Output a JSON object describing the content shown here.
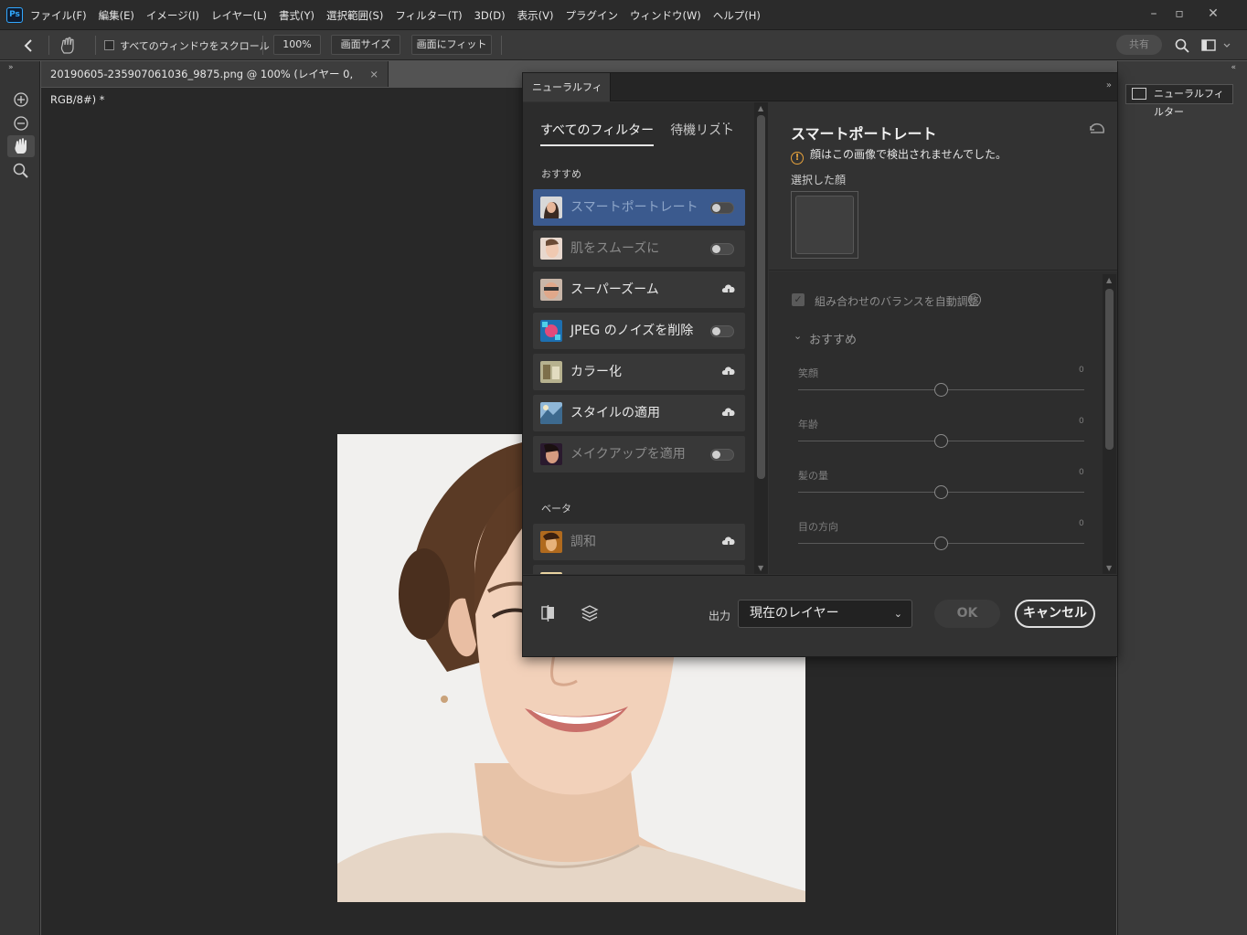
{
  "app": {
    "logo": "Ps",
    "menu": [
      "ファイル(F)",
      "編集(E)",
      "イメージ(I)",
      "レイヤー(L)",
      "書式(Y)",
      "選択範囲(S)",
      "フィルター(T)",
      "3D(D)",
      "表示(V)",
      "プラグイン",
      "ウィンドウ(W)",
      "ヘルプ(H)"
    ]
  },
  "options_bar": {
    "scroll_all_label": "すべてのウィンドウをスクロール",
    "zoom": "100%",
    "screen_size": "画面サイズ",
    "fit_screen": "画面にフィット",
    "share": "共有"
  },
  "document": {
    "tab_title": "20190605-235907061036_9875.png @ 100% (レイヤー 0, RGB/8#) *",
    "close": "×"
  },
  "right_dock": {
    "neural_filters_button": "ニューラルフィルター"
  },
  "neural_filters": {
    "panel_tab": "ニューラルフィルター",
    "tabs": {
      "all": "すべてのフィルター",
      "waitlist": "待機リスト",
      "more": "···"
    },
    "featured_label": "おすすめ",
    "beta_label": "ベータ",
    "filters": [
      {
        "name": "スマートポートレート",
        "state": "toggle-off",
        "selected": true,
        "dim": true
      },
      {
        "name": "肌をスムーズに",
        "state": "toggle-off",
        "selected": false,
        "dim": true
      },
      {
        "name": "スーパーズーム",
        "state": "cloud-download",
        "selected": false,
        "dim": false
      },
      {
        "name": "JPEG のノイズを削除",
        "state": "toggle-off",
        "selected": false,
        "dim": false
      },
      {
        "name": "カラー化",
        "state": "cloud-download",
        "selected": false,
        "dim": false
      },
      {
        "name": "スタイルの適用",
        "state": "cloud-download",
        "selected": false,
        "dim": false
      },
      {
        "name": "メイクアップを適用",
        "state": "toggle-off",
        "selected": false,
        "dim": true
      }
    ],
    "beta_filters": [
      {
        "name": "調和",
        "state": "cloud-download",
        "dim": true
      }
    ],
    "detail": {
      "title": "スマートポートレート",
      "warning": "顔はこの画像で検出されませんでした。",
      "selected_face_label": "選択した顔",
      "auto_balance_label": "組み合わせのバランスを自動調整",
      "auto_balance_checked": true,
      "recommended_label": "おすすめ",
      "sliders": [
        {
          "label": "笑顔",
          "value": "0",
          "level": 0.5
        },
        {
          "label": "年齢",
          "value": "0",
          "level": 0.5
        },
        {
          "label": "髪の量",
          "value": "0",
          "level": 0.5
        },
        {
          "label": "目の方向",
          "value": "0",
          "level": 0.5
        }
      ]
    },
    "footer": {
      "output_label": "出力",
      "output_value": "現在のレイヤー",
      "ok": "OK",
      "cancel": "キャンセル"
    }
  }
}
